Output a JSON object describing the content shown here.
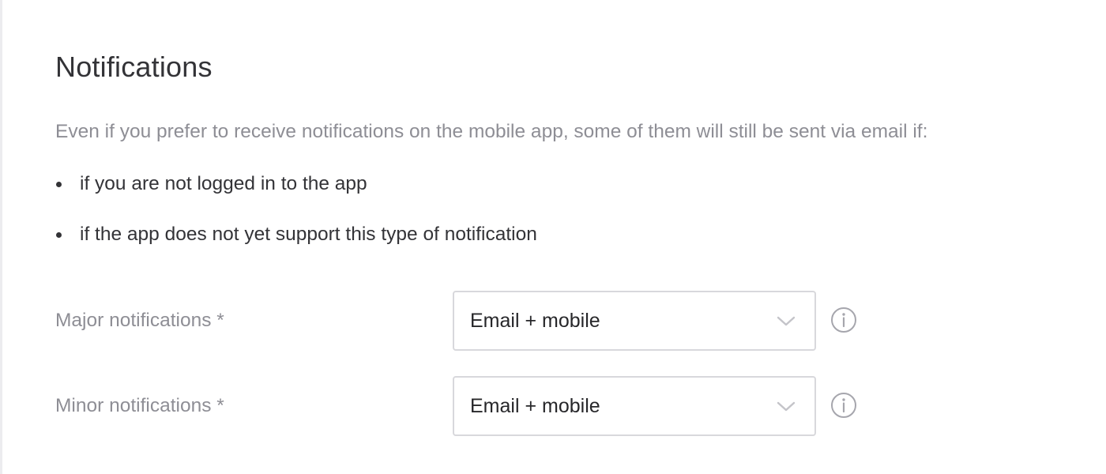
{
  "section": {
    "title": "Notifications",
    "intro": "Even if you prefer to receive notifications on the mobile app, some of them will still be sent via email if:",
    "bullets": [
      "if you are not logged in to the app",
      "if the app does not yet support this type of notification"
    ]
  },
  "fields": {
    "major": {
      "label": "Major notifications *",
      "value": "Email + mobile",
      "icon": "info-icon"
    },
    "minor": {
      "label": "Minor notifications *",
      "value": "Email + mobile",
      "icon": "info-icon"
    }
  },
  "colors": {
    "title": "#333337",
    "muted_text": "#8e8e95",
    "select_border": "#d8d8dc",
    "icon": "#a6a6ad"
  }
}
